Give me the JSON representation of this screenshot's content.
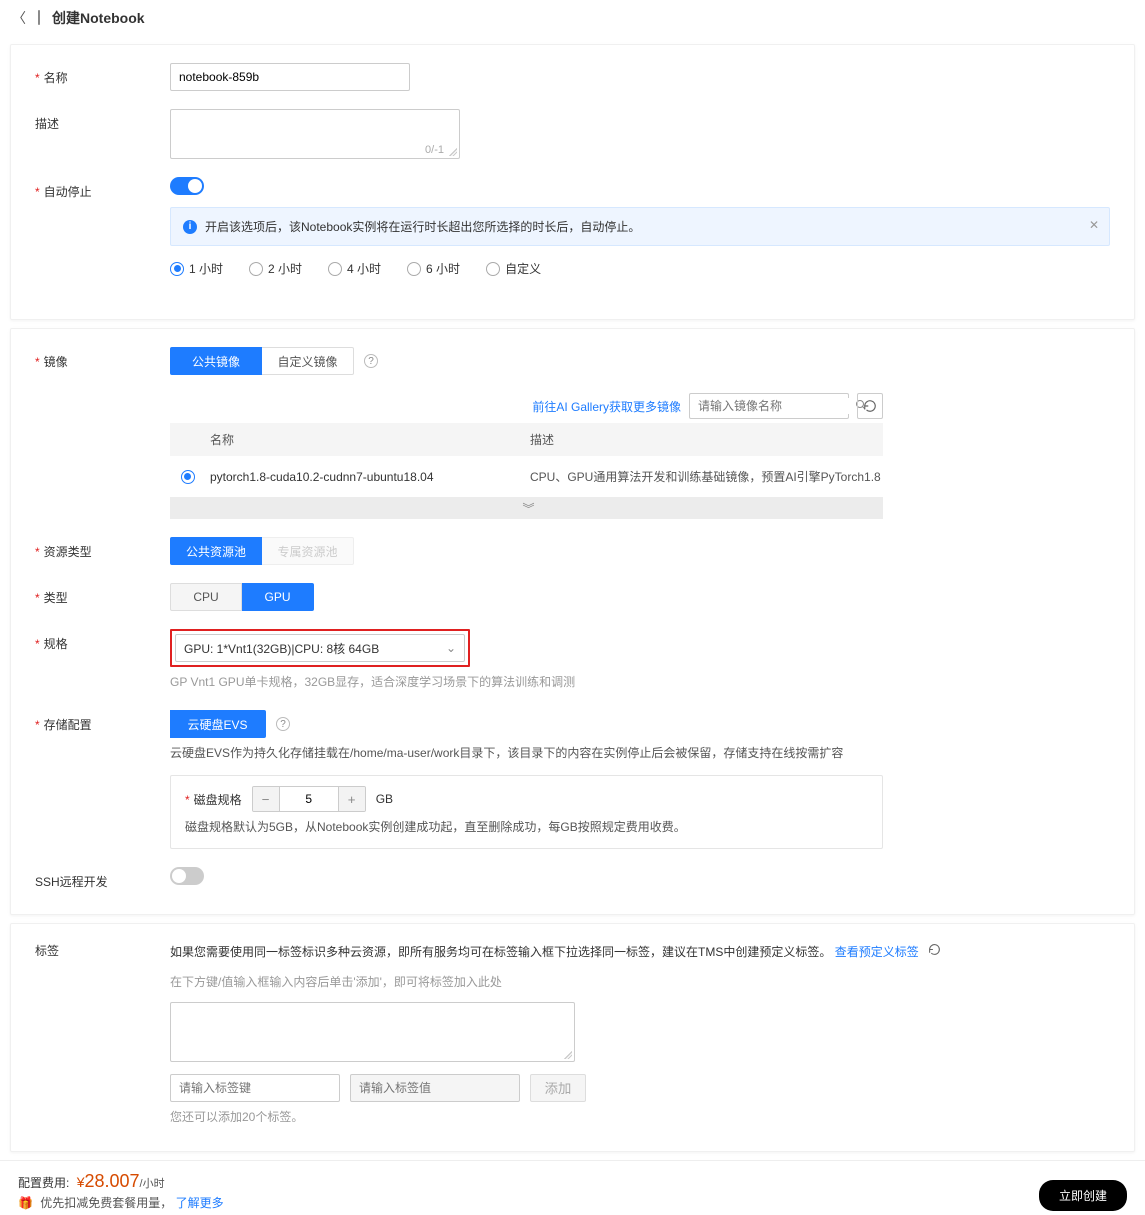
{
  "header": {
    "title": "创建Notebook"
  },
  "name": {
    "label": "名称",
    "value": "notebook-859b"
  },
  "desc": {
    "label": "描述",
    "counter": "0/-1"
  },
  "autostop": {
    "label": "自动停止",
    "banner": "开启该选项后，该Notebook实例将在运行时长超出您所选择的时长后，自动停止。",
    "options": [
      "1 小时",
      "2 小时",
      "4 小时",
      "6 小时",
      "自定义"
    ]
  },
  "image": {
    "label": "镜像",
    "tabs": [
      "公共镜像",
      "自定义镜像"
    ],
    "gallery_link": "前往AI Gallery获取更多镜像",
    "search_placeholder": "请输入镜像名称",
    "th_name": "名称",
    "th_desc": "描述",
    "row_name": "pytorch1.8-cuda10.2-cudnn7-ubuntu18.04",
    "row_desc": "CPU、GPU通用算法开发和训练基础镜像，预置AI引擎PyTorch1.8"
  },
  "resource": {
    "label": "资源类型",
    "tabs": [
      "公共资源池",
      "专属资源池"
    ]
  },
  "type": {
    "label": "类型",
    "tabs": [
      "CPU",
      "GPU"
    ]
  },
  "spec": {
    "label": "规格",
    "value": "GPU: 1*Vnt1(32GB)|CPU: 8核 64GB",
    "hint": "GP Vnt1 GPU单卡规格，32GB显存，适合深度学习场景下的算法训练和调测"
  },
  "storage": {
    "label": "存储配置",
    "tab": "云硬盘EVS",
    "hint": "云硬盘EVS作为持久化存储挂载在/home/ma-user/work目录下，该目录下的内容在实例停止后会被保留，存储支持在线按需扩容",
    "disk_label": "磁盘规格",
    "disk_value": "5",
    "disk_unit": "GB",
    "disk_hint": "磁盘规格默认为5GB，从Notebook实例创建成功起，直至删除成功，每GB按照规定费用收费。"
  },
  "ssh": {
    "label": "SSH远程开发"
  },
  "tags": {
    "label": "标签",
    "line1_pre": "如果您需要使用同一标签标识多种云资源，即所有服务均可在标签输入框下拉选择同一标签，建议在TMS中创建预定义标签。",
    "link": "查看预定义标签",
    "line2": "在下方键/值输入框输入内容后单击'添加'，即可将标签加入此处",
    "key_ph": "请输入标签键",
    "val_ph": "请输入标签值",
    "add": "添加",
    "remain": "您还可以添加20个标签。"
  },
  "footer": {
    "cost_label": "配置费用:",
    "price": "28.007",
    "per": "/小时",
    "coupon": "优先扣减免费套餐用量，",
    "learn": "了解更多",
    "create": "立即创建"
  }
}
